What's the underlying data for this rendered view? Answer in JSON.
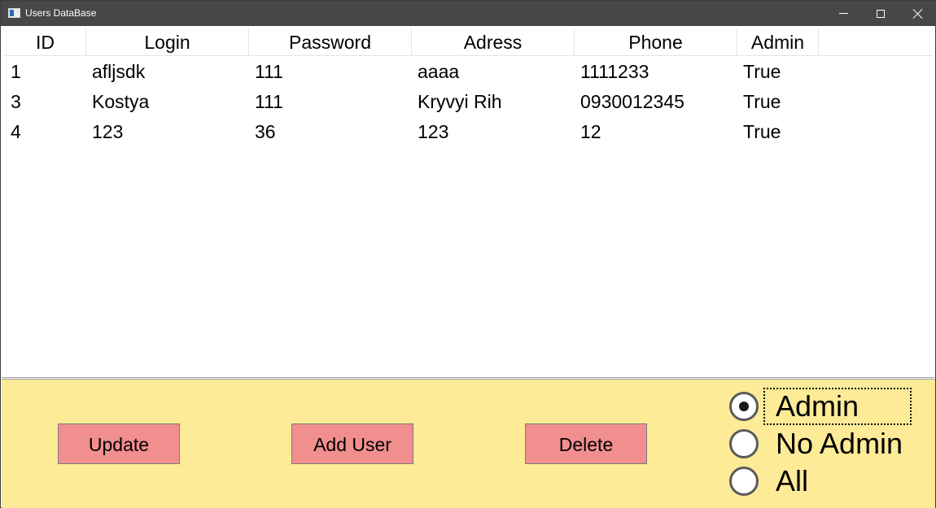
{
  "window": {
    "title": "Users DataBase"
  },
  "table": {
    "columns": [
      "ID",
      "Login",
      "Password",
      "Adress",
      "Phone",
      "Admin"
    ],
    "rows": [
      [
        "1",
        "afljsdk",
        "111",
        "aaaa",
        "1111233",
        "True"
      ],
      [
        "3",
        "Kostya",
        "111",
        "Kryvyi Rih",
        "0930012345",
        "True"
      ],
      [
        "4",
        "123",
        "36",
        "123",
        "12",
        "True"
      ]
    ]
  },
  "buttons": {
    "update": "Update",
    "add_user": "Add User",
    "delete": "Delete"
  },
  "filter": {
    "options": [
      "Admin",
      "No Admin",
      "All"
    ],
    "selected": "Admin"
  },
  "colors": {
    "panel_bg": "#fdeb97",
    "button_bg": "#f18e8e",
    "titlebar_bg": "#474747"
  }
}
